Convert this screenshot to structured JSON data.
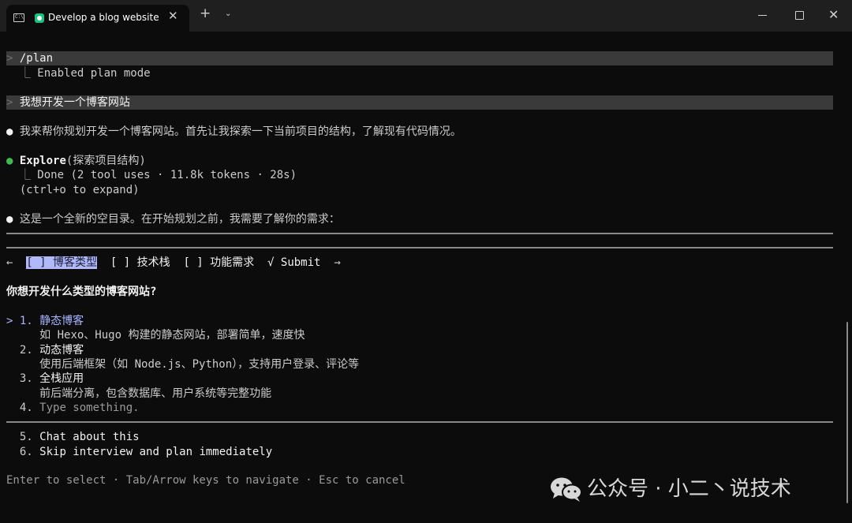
{
  "window": {
    "tab_title": "Develop a blog website",
    "tab_close": "✕",
    "new_tab": "+",
    "tab_dropdown": "⌄",
    "terminal_icon_text": "C:\\",
    "minimize": "—",
    "close": "✕"
  },
  "session": {
    "cmd_marker": ">",
    "plan_cmd": "/plan",
    "plan_result_branch": "⎿",
    "plan_result": "Enabled plan mode",
    "user_prompt": "我想开发一个博客网站",
    "bullet": "●",
    "assistant_msg1": "我来帮你规划开发一个博客网站。首先让我探索一下当前项目的结构，了解现有代码情况。",
    "explore_tool": "Explore",
    "explore_arg": "(探索项目结构)",
    "explore_branch": "⎿",
    "explore_result": "Done (2 tool uses · 11.8k tokens · 28s)",
    "expand_hint": "(ctrl+o to expand)",
    "assistant_msg2": "这是一个全新的空目录。在开始规划之前，我需要了解你的需求："
  },
  "question_tabs": {
    "left_arrow": "←",
    "right_arrow": "→",
    "tabs": [
      {
        "label": "[ ] 博客类型",
        "selected": true
      },
      {
        "label": "[ ] 技术栈",
        "selected": false
      },
      {
        "label": "[ ] 功能需求",
        "selected": false
      }
    ],
    "submit": "√ Submit"
  },
  "question": "你想开发什么类型的博客网站?",
  "options": [
    {
      "num": "1.",
      "label": "静态博客",
      "desc": "如 Hexo、Hugo 构建的静态网站，部署简单，速度快",
      "selected": true
    },
    {
      "num": "2.",
      "label": "动态博客",
      "desc": "使用后端框架（如 Node.js、Python），支持用户登录、评论等"
    },
    {
      "num": "3.",
      "label": "全栈应用",
      "desc": "前后端分离，包含数据库、用户系统等完整功能"
    },
    {
      "num": "4.",
      "label": "Type something."
    }
  ],
  "selector": ">",
  "extra_options": [
    {
      "num": "5.",
      "label": "Chat about this"
    },
    {
      "num": "6.",
      "label": "Skip interview and plan immediately"
    }
  ],
  "footer_hint": "Enter to select · Tab/Arrow keys to navigate · Esc to cancel",
  "watermark": "公众号 · 小二丶说技术",
  "colors": {
    "background": "#0c0c0c",
    "highlight": "#3a3a3a",
    "accent": "#a8b4ff",
    "tab_selected_bg": "#b1b9f9",
    "success": "#3fb950"
  }
}
